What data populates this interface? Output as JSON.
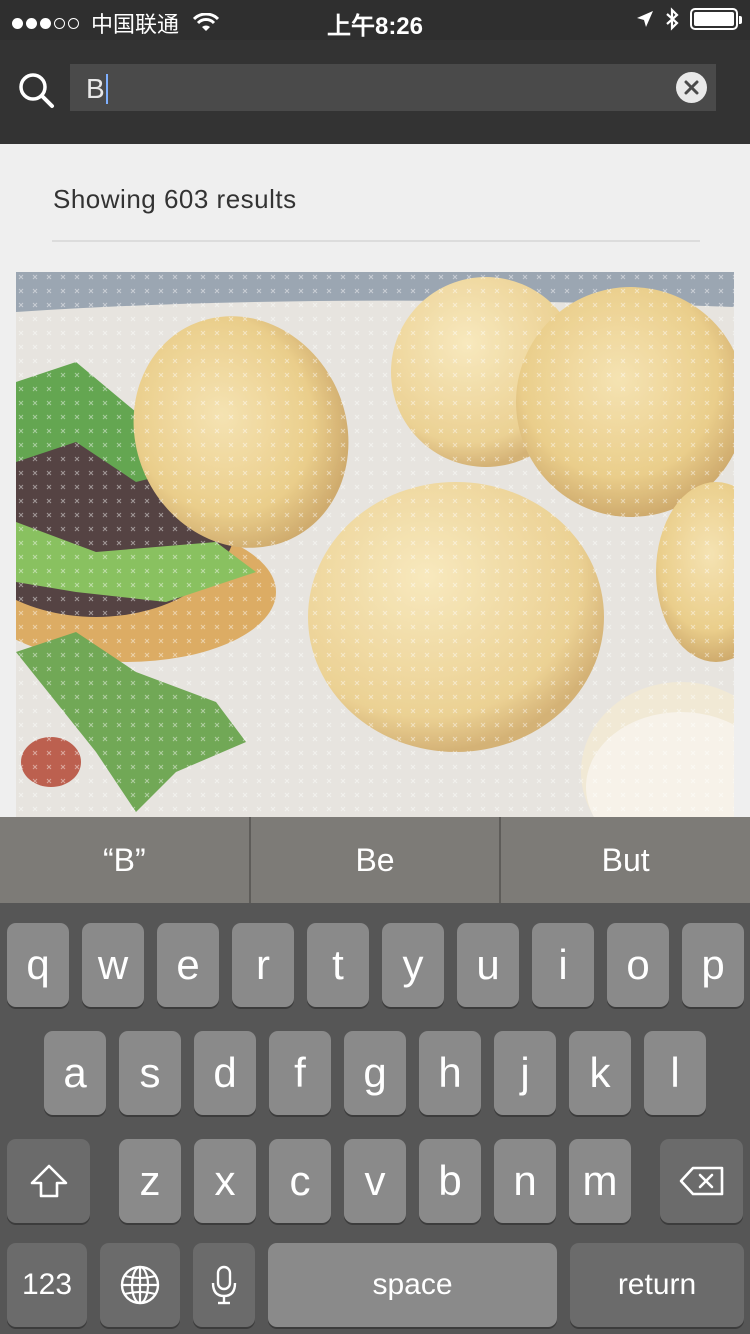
{
  "status_bar": {
    "carrier": "中国联通",
    "time": "上午8:26",
    "signal_filled": 3,
    "signal_total": 5
  },
  "search": {
    "query": "B",
    "icon": "search-icon",
    "clear_icon": "clear-icon"
  },
  "results": {
    "count_text": "Showing 603 results"
  },
  "predictions": [
    "“B”",
    "Be",
    "But"
  ],
  "keyboard": {
    "row1": [
      "q",
      "w",
      "e",
      "r",
      "t",
      "y",
      "u",
      "i",
      "o",
      "p"
    ],
    "row2": [
      "a",
      "s",
      "d",
      "f",
      "g",
      "h",
      "j",
      "k",
      "l"
    ],
    "row3": [
      "z",
      "x",
      "c",
      "v",
      "b",
      "n",
      "m"
    ],
    "numbers_label": "123",
    "space_label": "space",
    "return_label": "return",
    "icons": {
      "shift": "shift-icon",
      "delete": "delete-icon",
      "globe": "globe-icon",
      "mic": "microphone-icon"
    }
  }
}
